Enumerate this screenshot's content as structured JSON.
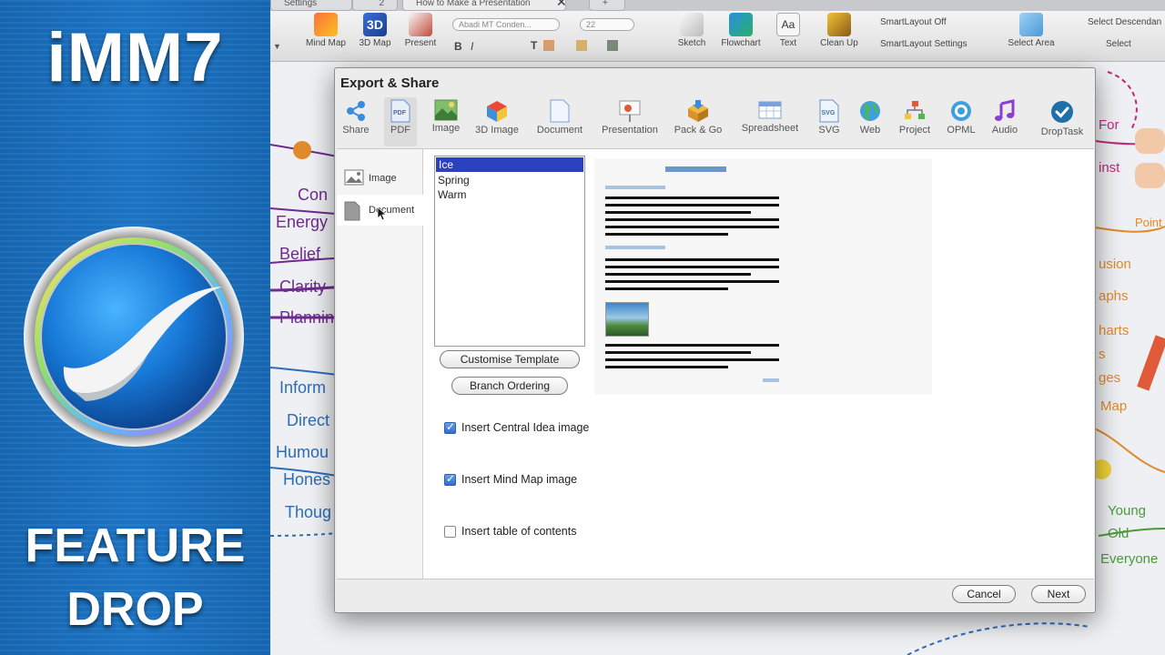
{
  "promo": {
    "brand": "iMM7",
    "feature_line1": "FEATURE",
    "feature_line2": "DROP"
  },
  "app": {
    "tabs": [
      "Settings",
      "2",
      "How to Make a Presentation",
      "+"
    ],
    "ribbon": {
      "items": [
        "Mind Map",
        "3D Map",
        "Present",
        "Sketch",
        "Flowchart",
        "Text",
        "Clean Up",
        "Select Area"
      ],
      "font_name": "Abadi MT Conden...",
      "font_size": "22",
      "smartlayout_off": "SmartLayout Off",
      "smartlayout_settings": "SmartLayout Settings",
      "select_descendants": "Select Descendan",
      "select": "Select"
    },
    "mindmap_left": [
      "Con",
      "Energy",
      "Belief",
      "Clarity",
      "Plannin",
      "Inform",
      "Direct",
      "Humou",
      "Hones",
      "Thoug"
    ],
    "mindmap_right": [
      "For",
      "inst",
      "Point",
      "usion",
      "aphs",
      "harts",
      "s",
      "ges",
      "Map",
      "Young",
      "Old",
      "Everyone"
    ]
  },
  "dialog": {
    "title": "Export & Share",
    "formats": [
      {
        "label": "Share",
        "icon": "share-icon"
      },
      {
        "label": "PDF",
        "icon": "pdf-icon"
      },
      {
        "label": "Image",
        "icon": "image-icon"
      },
      {
        "label": "3D Image",
        "icon": "cube-icon"
      },
      {
        "label": "Document",
        "icon": "document-icon"
      },
      {
        "label": "Presentation",
        "icon": "presentation-icon"
      },
      {
        "label": "Pack & Go",
        "icon": "package-icon"
      },
      {
        "label": "Spreadsheet",
        "icon": "spreadsheet-icon"
      },
      {
        "label": "SVG",
        "icon": "svg-icon"
      },
      {
        "label": "Web",
        "icon": "globe-icon"
      },
      {
        "label": "Project",
        "icon": "project-icon"
      },
      {
        "label": "OPML",
        "icon": "opml-icon"
      },
      {
        "label": "Audio",
        "icon": "music-icon"
      },
      {
        "label": "DropTask",
        "icon": "droptask-icon"
      }
    ],
    "active_format": "PDF",
    "sidebar": [
      {
        "label": "Image"
      },
      {
        "label": "Document"
      }
    ],
    "selected_sidebar": "Document",
    "templates": [
      "Ice",
      "Spring",
      "Warm"
    ],
    "selected_template": "Ice",
    "customise_template": "Customise Template",
    "branch_ordering": "Branch Ordering",
    "options": [
      {
        "label": "Insert Central Idea image",
        "checked": true
      },
      {
        "label": "Insert Mind Map image",
        "checked": true
      },
      {
        "label": "Insert table of contents",
        "checked": false
      }
    ],
    "cancel": "Cancel",
    "next": "Next"
  },
  "colors": {
    "promo_blue": "#1c74c4",
    "selection_blue": "#2a41c0",
    "mindmap_purple": "#6e2a8f",
    "mindmap_blue": "#2c6db8",
    "mindmap_orange": "#e08a2c",
    "mindmap_green": "#4a9a3a",
    "mindmap_pink": "#c02a7a"
  }
}
